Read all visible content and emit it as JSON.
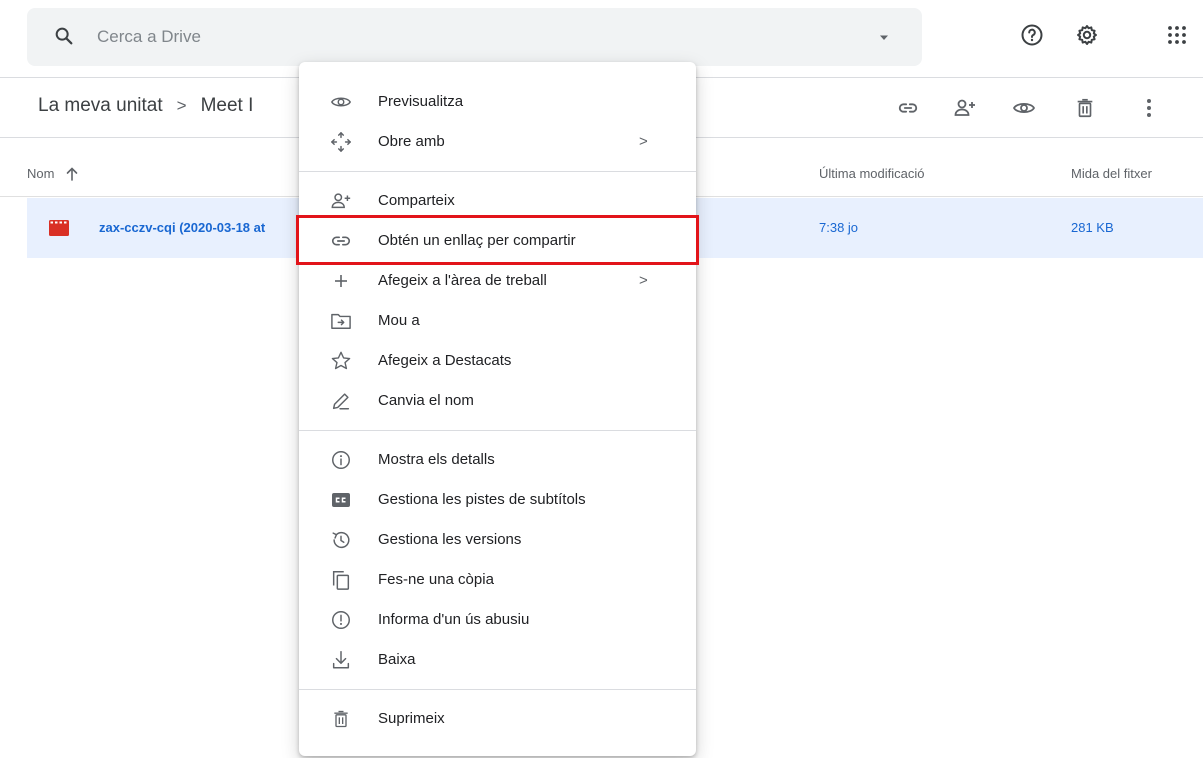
{
  "search": {
    "placeholder": "Cerca a Drive"
  },
  "breadcrumb": {
    "root": "La meva unitat",
    "separator": ">",
    "current": "Meet I"
  },
  "list": {
    "headers": {
      "name": "Nom",
      "modified": "Última modificació",
      "size": "Mida del fitxer"
    },
    "file": {
      "name": "zax-cczv-cqi (2020-03-18 at",
      "modified": "7:38 jo",
      "size": "281 KB"
    }
  },
  "menu": {
    "items": [
      {
        "label": "Previsualitza",
        "icon": "eye-icon"
      },
      {
        "label": "Obre amb",
        "icon": "move-arrows-icon",
        "submenu": ">"
      },
      {
        "label": "Comparteix",
        "icon": "person-add-icon"
      },
      {
        "label": "Obtén un enllaç per compartir",
        "icon": "link-icon"
      },
      {
        "label": "Afegeix a l'àrea de treball",
        "icon": "plus-icon",
        "submenu": ">"
      },
      {
        "label": "Mou a",
        "icon": "folder-move-icon"
      },
      {
        "label": "Afegeix a Destacats",
        "icon": "star-icon"
      },
      {
        "label": "Canvia el nom",
        "icon": "pencil-icon"
      },
      {
        "label": "Mostra els detalls",
        "icon": "info-icon"
      },
      {
        "label": "Gestiona les pistes de subtítols",
        "icon": "cc-icon"
      },
      {
        "label": "Gestiona les versions",
        "icon": "history-icon"
      },
      {
        "label": "Fes-ne una còpia",
        "icon": "copy-icon"
      },
      {
        "label": "Informa d'un ús abusiu",
        "icon": "report-icon"
      },
      {
        "label": "Baixa",
        "icon": "download-icon"
      },
      {
        "label": "Suprimeix",
        "icon": "trash-icon"
      }
    ]
  },
  "colors": {
    "selection_bg": "#e8f0fe",
    "link_blue": "#1967d2",
    "highlight_red": "#e2141a"
  }
}
